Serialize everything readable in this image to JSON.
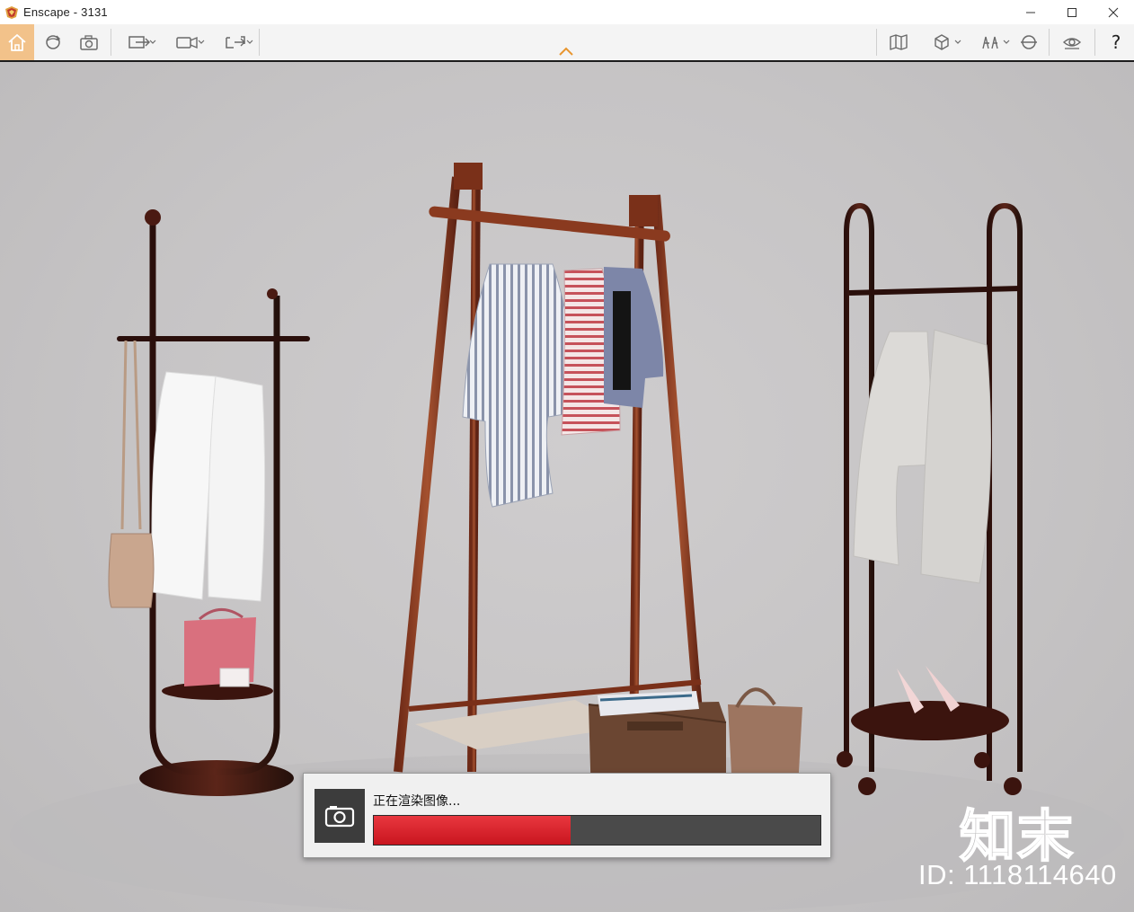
{
  "window": {
    "title": "Enscape - 3131",
    "controls": {
      "minimize": "—",
      "maximize": "☐",
      "close": "✕"
    }
  },
  "toolbar": {
    "left_icons": [
      "home-icon",
      "orbit-icon",
      "screenshot-icon",
      "export-icon",
      "video-icon",
      "panorama-icon"
    ],
    "right_icons": [
      "map-icon",
      "cube-icon",
      "people-icon",
      "section-icon",
      "visibility-icon"
    ],
    "help_label": "?",
    "colors": {
      "home_bg": "#f2c28a",
      "icon": "#6a6a6a"
    }
  },
  "render": {
    "status_text": "正在渲染图像...",
    "progress": 0.44,
    "colors": {
      "fill": "#d8222b",
      "track": "#4a4a4a"
    }
  },
  "watermark": {
    "brand": "知末",
    "id_text": "ID: 1118114640"
  }
}
